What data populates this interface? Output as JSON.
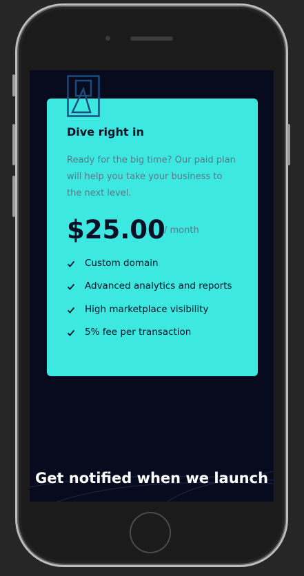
{
  "plan": {
    "name": "Dive right in",
    "description": "Ready for the big time? Our paid plan will help you take your business to the next level.",
    "price": "$25.00",
    "period": "/ month",
    "features": [
      "Custom domain",
      "Advanced analytics and reports",
      "High marketplace visibility",
      "5% fee per transaction"
    ]
  },
  "notify": {
    "title": "Get notified when we launch"
  },
  "colors": {
    "card_bg": "#3de8e0",
    "page_bg": "#070b1d",
    "text_dark": "#0b1026",
    "text_muted": "#5e7689",
    "icon": "#1a4d7e"
  },
  "icons": {
    "plan": "triangle-square-icon",
    "feature": "check-icon"
  }
}
